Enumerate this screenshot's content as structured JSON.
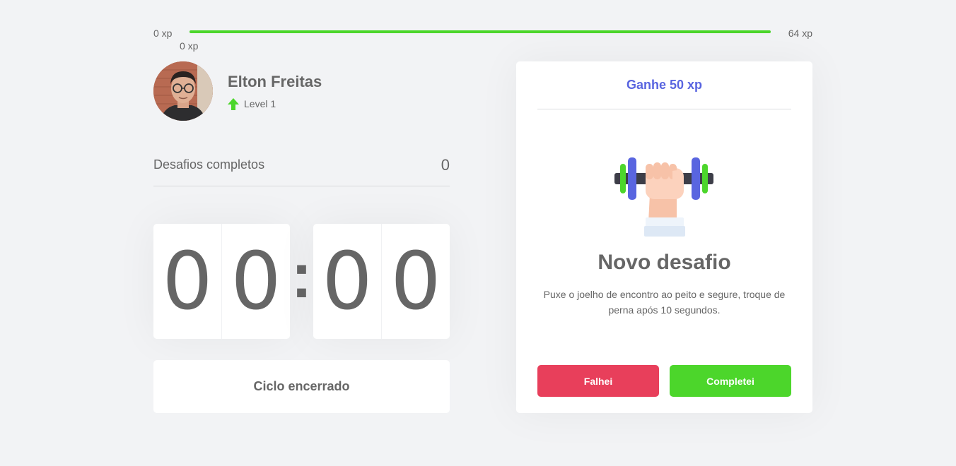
{
  "xp": {
    "min_label": "0 xp",
    "max_label": "64 xp",
    "current_label": "0 xp",
    "progress_fraction": 1.0
  },
  "profile": {
    "name": "Elton Freitas",
    "level": "Level 1"
  },
  "completed": {
    "label": "Desafios completos",
    "count": "0"
  },
  "countdown": {
    "minute_left": "0",
    "minute_right": "0",
    "separator": ":",
    "second_left": "0",
    "second_right": "0"
  },
  "cycle_button": "Ciclo encerrado",
  "challenge": {
    "reward": "Ganhe 50 xp",
    "icon": "dumbbell-icon",
    "title": "Novo desafio",
    "description": "Puxe o joelho de encontro ao peito e segure, troque de perna após 10 segundos.",
    "fail_label": "Falhei",
    "success_label": "Completei"
  },
  "colors": {
    "background": "#f2f3f5",
    "accent_blue": "#5965e0",
    "success_green": "#4cd62b",
    "fail_red": "#e83f5b",
    "text": "#666666"
  }
}
